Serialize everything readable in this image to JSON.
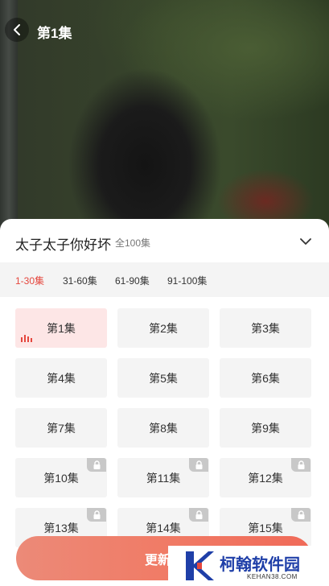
{
  "header": {
    "title": "第1集"
  },
  "drama": {
    "title": "太子太子你好坏",
    "count": "全100集"
  },
  "ranges": [
    {
      "label": "1-30集",
      "active": true
    },
    {
      "label": "31-60集",
      "active": false
    },
    {
      "label": "61-90集",
      "active": false
    },
    {
      "label": "91-100集",
      "active": false
    }
  ],
  "episodes": [
    {
      "label": "第1集",
      "state": "current"
    },
    {
      "label": "第2集",
      "state": "free"
    },
    {
      "label": "第3集",
      "state": "free"
    },
    {
      "label": "第4集",
      "state": "free"
    },
    {
      "label": "第5集",
      "state": "free"
    },
    {
      "label": "第6集",
      "state": "free"
    },
    {
      "label": "第7集",
      "state": "free"
    },
    {
      "label": "第8集",
      "state": "free"
    },
    {
      "label": "第9集",
      "state": "free"
    },
    {
      "label": "第10集",
      "state": "locked"
    },
    {
      "label": "第11集",
      "state": "locked"
    },
    {
      "label": "第12集",
      "state": "locked"
    },
    {
      "label": "第13集",
      "state": "locked"
    },
    {
      "label": "第14集",
      "state": "locked"
    },
    {
      "label": "第15集",
      "state": "locked"
    }
  ],
  "cta": {
    "label": "更新提"
  },
  "watermark": {
    "name": "柯翰软件园",
    "url": "KEHAN38.COM"
  },
  "colors": {
    "accent": "#e5473e",
    "current_bg": "#fde6e6",
    "tile_bg": "#f4f4f4",
    "watermark_blue": "#1f3fa8"
  }
}
